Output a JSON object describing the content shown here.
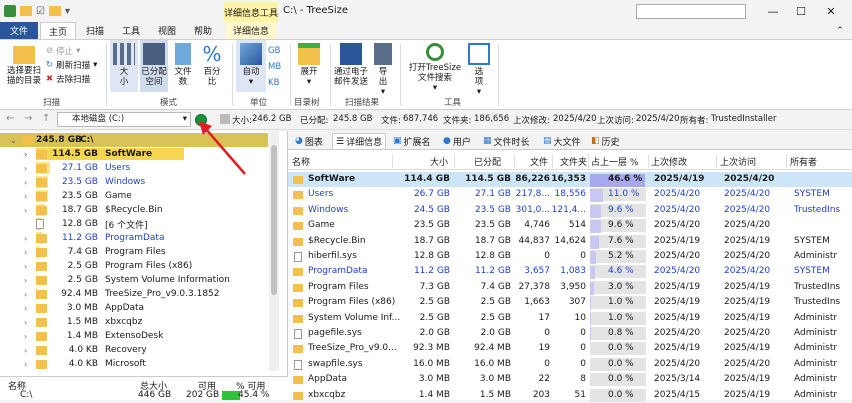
{
  "titlebar": {
    "context_tab": "详细信息工具",
    "title": "C:\\ - TreeSize"
  },
  "tabs": [
    "文件",
    "主页",
    "扫描",
    "工具",
    "视图",
    "帮助",
    "详细信息"
  ],
  "ribbon": {
    "scan_group": {
      "select_dir": "选择要扫描的目录",
      "stop": "停止",
      "refresh": "刷新扫描",
      "remove": "去除扫描",
      "label": "扫描"
    },
    "mode_group": {
      "size": "大小",
      "alloc": "已分配空间",
      "files": "文件数",
      "percent": "百分比",
      "label": "模式"
    },
    "unit_group": {
      "auto": "自动",
      "gb": "GB",
      "mb": "MB",
      "kb": "KB",
      "label": "单位"
    },
    "tree_group": {
      "expand": "展开",
      "label": "目录树"
    },
    "result_group": {
      "email": "通过电子邮件发送",
      "export": "导出",
      "label": "扫描结果"
    },
    "tools_group": {
      "open": "打开TreeSize文件搜索",
      "options": "选项",
      "label": "工具"
    }
  },
  "address": {
    "drive": "本地磁盘 (C:)",
    "size_label": "大小:",
    "size": "246.2 GB",
    "alloc_label": "已分配:",
    "alloc": "245.8 GB",
    "files_label": "文件:",
    "files": "687,746",
    "folders_label": "文件夹:",
    "folders": "186,656",
    "modified_label": "上次修改:",
    "modified": "2025/4/20",
    "accessed_label": "上次访问:",
    "accessed": "2025/4/20",
    "owner_label": "所有者:",
    "owner": "TrustedInstaller"
  },
  "tree": [
    {
      "size": "245.8 GB",
      "name": "C:\\"
    },
    {
      "size": "114.5 GB",
      "name": "SoftWare"
    },
    {
      "size": "27.1 GB",
      "name": "Users"
    },
    {
      "size": "23.5 GB",
      "name": "Windows"
    },
    {
      "size": "23.5 GB",
      "name": "Game"
    },
    {
      "size": "18.7 GB",
      "name": "$Recycle.Bin"
    },
    {
      "size": "12.8 GB",
      "name": "[6 个文件]"
    },
    {
      "size": "11.2 GB",
      "name": "ProgramData"
    },
    {
      "size": "7.4 GB",
      "name": "Program Files"
    },
    {
      "size": "2.5 GB",
      "name": "Program Files (x86)"
    },
    {
      "size": "2.5 GB",
      "name": "System Volume Information"
    },
    {
      "size": "92.4 MB",
      "name": "TreeSize_Pro_v9.0.3.1852"
    },
    {
      "size": "3.0 MB",
      "name": "AppData"
    },
    {
      "size": "1.5 MB",
      "name": "xbxcqbz"
    },
    {
      "size": "1.4 MB",
      "name": "ExtensoDesk"
    },
    {
      "size": "4.0 KB",
      "name": "Recovery"
    },
    {
      "size": "4.0 KB",
      "name": "Microsoft"
    }
  ],
  "lower": {
    "headers": [
      "名称",
      "总大小",
      "可用",
      "% 可用"
    ],
    "row": {
      "name": "C:\\",
      "total": "446 GB",
      "free": "202 GB",
      "pct": "45.4 %"
    }
  },
  "right_tabs": [
    "图表",
    "详细信息",
    "扩展名",
    "用户",
    "文件时长",
    "大文件",
    "历史"
  ],
  "columns": [
    "名称",
    "大小",
    "已分配",
    "文件",
    "文件夹",
    "占上一层 %",
    "上次修改",
    "上次访问",
    "所有者"
  ],
  "rows": [
    {
      "name": "SoftWare",
      "size": "114.4 GB",
      "alloc": "114.5 GB",
      "files": "86,226",
      "folders": "16,353",
      "pct": "46.6 %",
      "mod": "2025/4/19",
      "acc": "2025/4/20",
      "owner": "",
      "bold": true,
      "blue": false,
      "p": 46.6
    },
    {
      "name": "Users",
      "size": "26.7 GB",
      "alloc": "27.1 GB",
      "files": "217,8...",
      "folders": "18,556",
      "pct": "11.0 %",
      "mod": "2025/4/20",
      "acc": "2025/4/20",
      "owner": "SYSTEM",
      "bold": false,
      "blue": true,
      "p": 11.0
    },
    {
      "name": "Windows",
      "size": "24.5 GB",
      "alloc": "23.5 GB",
      "files": "301,0...",
      "folders": "121,4...",
      "pct": "9.6 %",
      "mod": "2025/4/20",
      "acc": "2025/4/20",
      "owner": "TrustedIns",
      "bold": false,
      "blue": true,
      "p": 9.6
    },
    {
      "name": "Game",
      "size": "23.5 GB",
      "alloc": "23.5 GB",
      "files": "4,746",
      "folders": "514",
      "pct": "9.6 %",
      "mod": "2025/4/20",
      "acc": "2025/4/20",
      "owner": "",
      "bold": false,
      "blue": false,
      "p": 9.6
    },
    {
      "name": "$Recycle.Bin",
      "size": "18.7 GB",
      "alloc": "18.7 GB",
      "files": "44,837",
      "folders": "14,624",
      "pct": "7.6 %",
      "mod": "2025/4/19",
      "acc": "2025/4/19",
      "owner": "SYSTEM",
      "bold": false,
      "blue": false,
      "p": 7.6
    },
    {
      "name": "hiberfil.sys",
      "size": "12.8 GB",
      "alloc": "12.8 GB",
      "files": "0",
      "folders": "0",
      "pct": "5.2 %",
      "mod": "2025/4/20",
      "acc": "2025/4/20",
      "owner": "Administr",
      "bold": false,
      "blue": false,
      "p": 5.2
    },
    {
      "name": "ProgramData",
      "size": "11.2 GB",
      "alloc": "11.2 GB",
      "files": "3,657",
      "folders": "1,083",
      "pct": "4.6 %",
      "mod": "2025/4/20",
      "acc": "2025/4/20",
      "owner": "SYSTEM",
      "bold": false,
      "blue": true,
      "p": 4.6
    },
    {
      "name": "Program Files",
      "size": "7.3 GB",
      "alloc": "7.4 GB",
      "files": "27,378",
      "folders": "3,950",
      "pct": "3.0 %",
      "mod": "2025/4/19",
      "acc": "2025/4/19",
      "owner": "TrustedIns",
      "bold": false,
      "blue": false,
      "p": 3.0
    },
    {
      "name": "Program Files (x86)",
      "size": "2.5 GB",
      "alloc": "2.5 GB",
      "files": "1,663",
      "folders": "307",
      "pct": "1.0 %",
      "mod": "2025/4/19",
      "acc": "2025/4/19",
      "owner": "TrustedIns",
      "bold": false,
      "blue": false,
      "p": 1.0
    },
    {
      "name": "System Volume Inf...",
      "size": "2.5 GB",
      "alloc": "2.5 GB",
      "files": "17",
      "folders": "10",
      "pct": "1.0 %",
      "mod": "2025/4/19",
      "acc": "2025/4/19",
      "owner": "Administr",
      "bold": false,
      "blue": false,
      "p": 1.0
    },
    {
      "name": "pagefile.sys",
      "size": "2.0 GB",
      "alloc": "2.0 GB",
      "files": "0",
      "folders": "0",
      "pct": "0.8 %",
      "mod": "2025/4/20",
      "acc": "2025/4/20",
      "owner": "Administr",
      "bold": false,
      "blue": false,
      "p": 0.8
    },
    {
      "name": "TreeSize_Pro_v9.0...",
      "size": "92.3 MB",
      "alloc": "92.4 MB",
      "files": "19",
      "folders": "0",
      "pct": "0.0 %",
      "mod": "2025/4/19",
      "acc": "2025/4/19",
      "owner": "Administr",
      "bold": false,
      "blue": false,
      "p": 0
    },
    {
      "name": "swapfile.sys",
      "size": "16.0 MB",
      "alloc": "16.0 MB",
      "files": "0",
      "folders": "0",
      "pct": "0.0 %",
      "mod": "2025/4/20",
      "acc": "2025/4/20",
      "owner": "Administr",
      "bold": false,
      "blue": false,
      "p": 0
    },
    {
      "name": "AppData",
      "size": "3.0 MB",
      "alloc": "3.0 MB",
      "files": "22",
      "folders": "8",
      "pct": "0.0 %",
      "mod": "2025/3/14",
      "acc": "2025/4/19",
      "owner": "Administr",
      "bold": false,
      "blue": false,
      "p": 0
    },
    {
      "name": "xbxcqbz",
      "size": "1.4 MB",
      "alloc": "1.5 MB",
      "files": "203",
      "folders": "51",
      "pct": "0.0 %",
      "mod": "2025/4/15",
      "acc": "2025/4/19",
      "owner": "Administr",
      "bold": false,
      "blue": false,
      "p": 0
    }
  ],
  "colors": {
    "accent": "#2b579a",
    "selected": "#cde6f7",
    "pct_bar": "#a8a8ee",
    "tree_bar": "#fbe48a",
    "go": "#1a8f3c"
  }
}
